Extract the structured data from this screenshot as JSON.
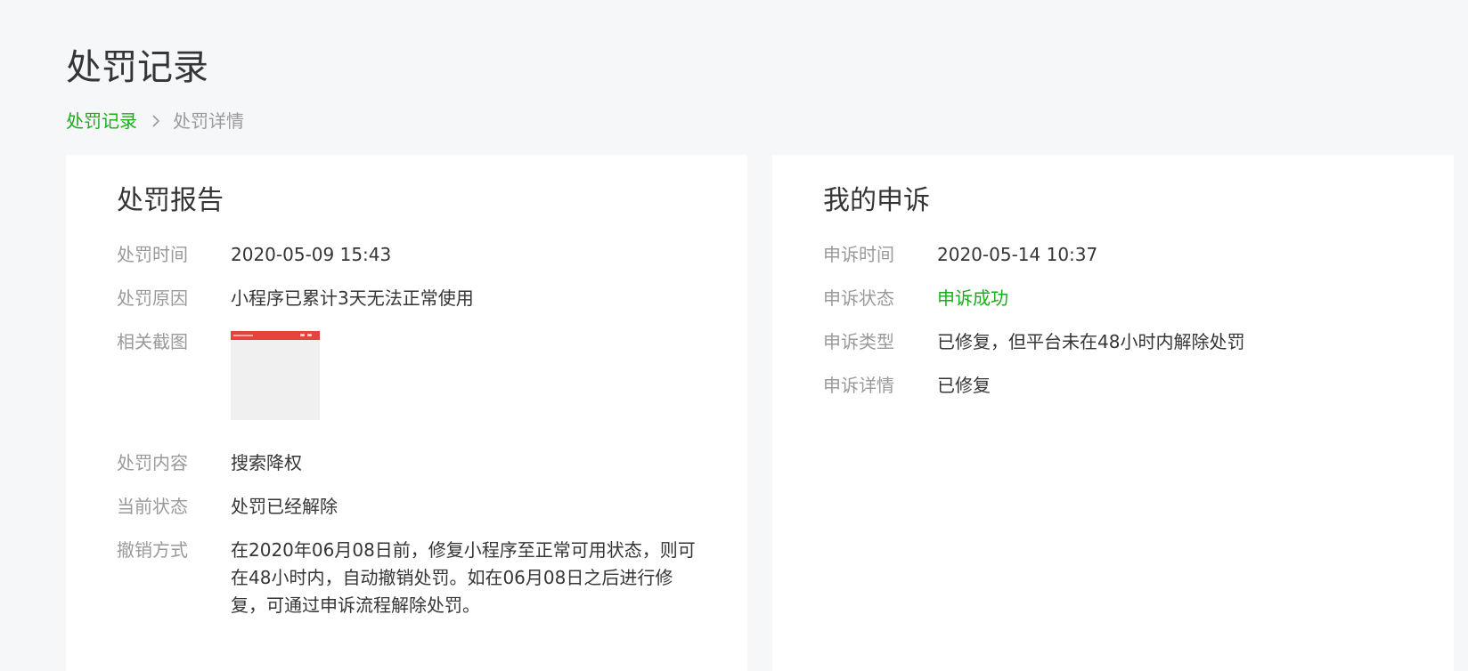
{
  "header": {
    "title": "处罚记录"
  },
  "breadcrumb": {
    "parent": "处罚记录",
    "separator": "›",
    "current": "处罚详情"
  },
  "report": {
    "title": "处罚报告",
    "rows": [
      {
        "label": "处罚时间",
        "value": "2020-05-09 15:43"
      },
      {
        "label": "处罚原因",
        "value": "小程序已累计3天无法正常使用"
      },
      {
        "label": "相关截图",
        "value": ""
      },
      {
        "label": "处罚内容",
        "value": "搜索降权"
      },
      {
        "label": "当前状态",
        "value": "处罚已经解除"
      },
      {
        "label": "撤销方式",
        "value": "在2020年06月08日前，修复小程序至正常可用状态，则可在48小时内，自动撤销处罚。如在06月08日之后进行修复，可通过申诉流程解除处罚。"
      }
    ]
  },
  "appeal": {
    "title": "我的申诉",
    "rows": [
      {
        "label": "申诉时间",
        "value": "2020-05-14 10:37"
      },
      {
        "label": "申诉状态",
        "value": "申诉成功"
      },
      {
        "label": "申诉类型",
        "value": "已修复，但平台未在48小时内解除处罚"
      },
      {
        "label": "申诉详情",
        "value": "已修复"
      }
    ]
  },
  "colors": {
    "brand_green": "#1aad19",
    "label_gray": "#9a9a9a",
    "text_dark": "#353535",
    "thumbnail_header_red": "#e64340",
    "page_background": "#f6f7f9"
  }
}
